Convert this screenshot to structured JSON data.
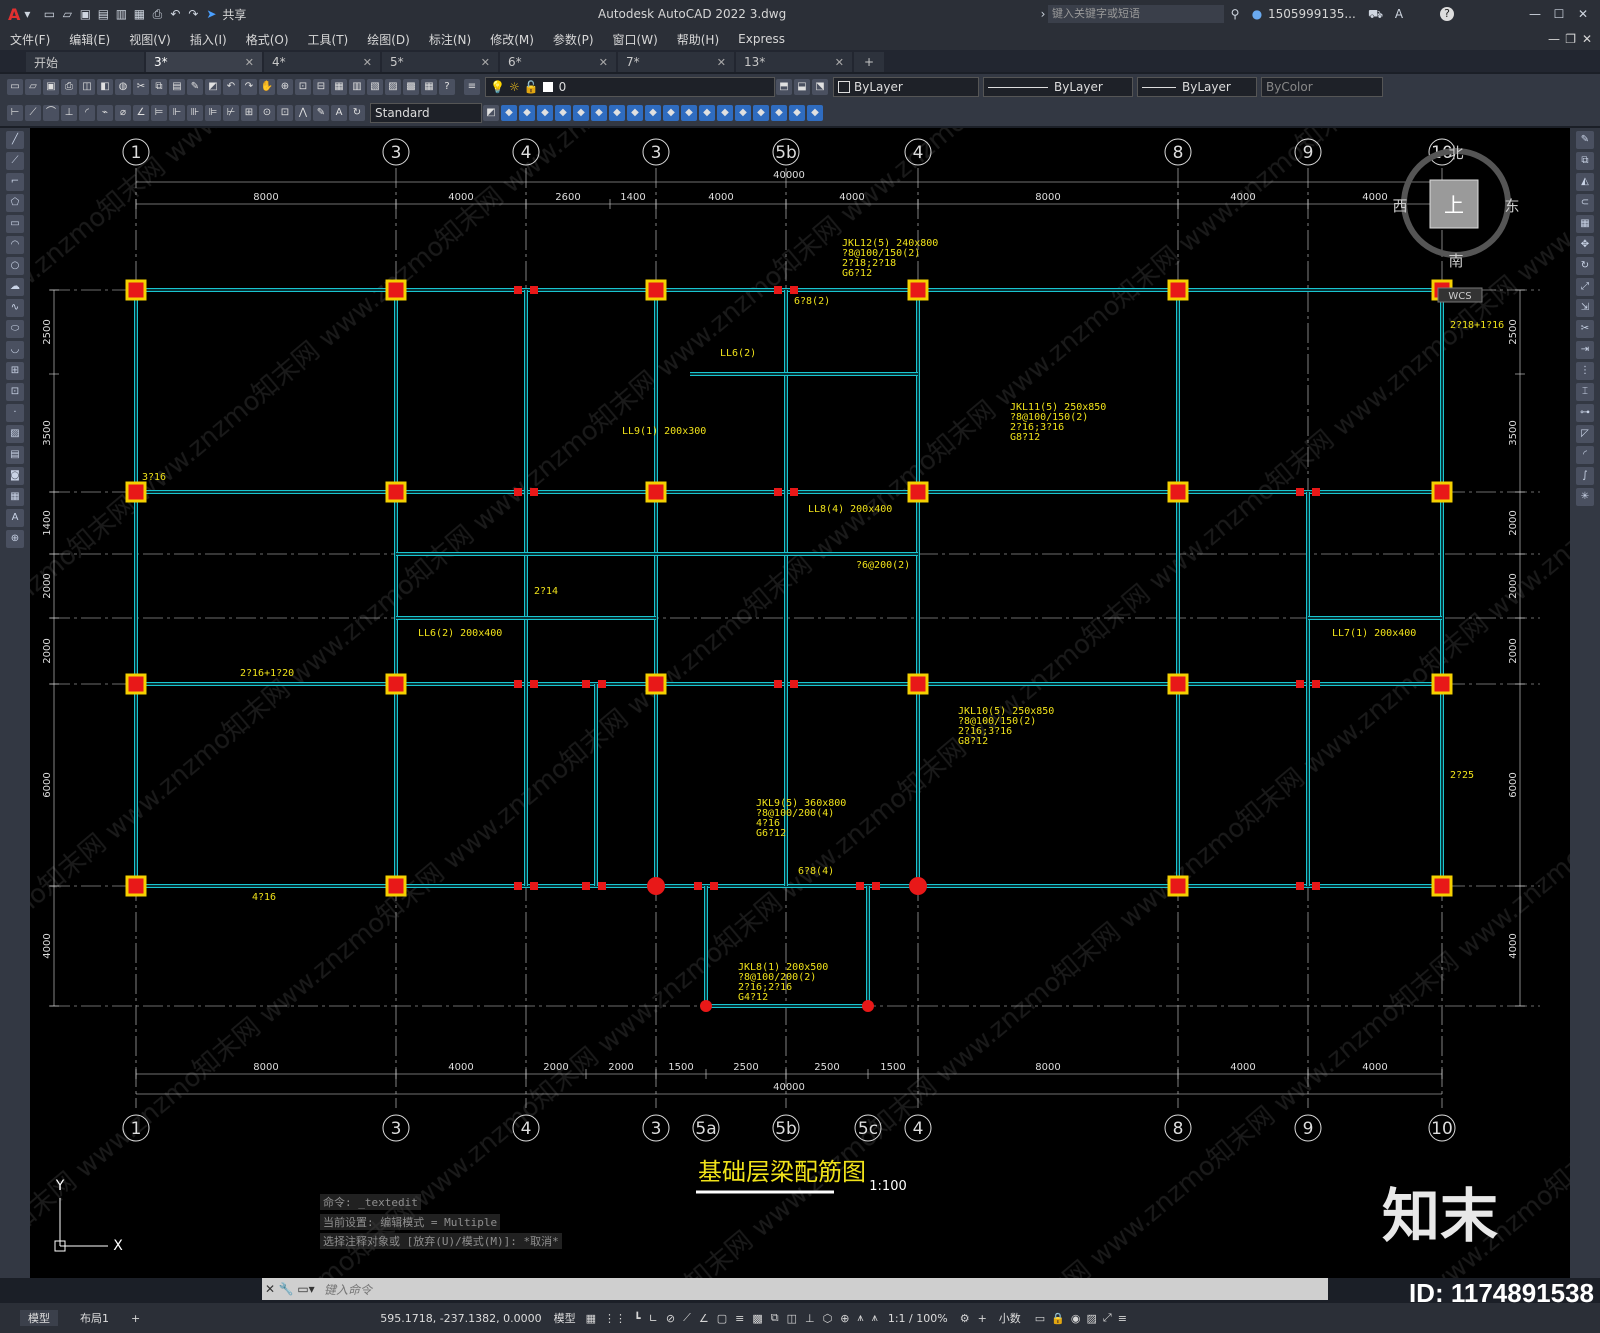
{
  "window": {
    "title": "Autodesk AutoCAD 2022    3.dwg",
    "share": "共享",
    "search_placeholder": "键入关键字或短语",
    "user": "1505999135...",
    "help": "?"
  },
  "menu": [
    "文件(F)",
    "编辑(E)",
    "视图(V)",
    "插入(I)",
    "格式(O)",
    "工具(T)",
    "绘图(D)",
    "标注(N)",
    "修改(M)",
    "参数(P)",
    "窗口(W)",
    "帮助(H)",
    "Express"
  ],
  "tabs": [
    {
      "label": "开始"
    },
    {
      "label": "3*"
    },
    {
      "label": "4*"
    },
    {
      "label": "5*"
    },
    {
      "label": "6*"
    },
    {
      "label": "7*"
    },
    {
      "label": "13*"
    }
  ],
  "toolbar": {
    "layer_value": "0",
    "color": "ByLayer",
    "linetype": "ByLayer",
    "lineweight": "ByLayer",
    "plotstyle": "ByColor",
    "text_style": "Standard"
  },
  "viewcube": {
    "north": "北",
    "south": "南",
    "west": "西",
    "east": "东",
    "top": "上",
    "wcs": "WCS"
  },
  "drawing": {
    "title": "基础层梁配筋图",
    "scale": "1:100",
    "top_axes": [
      "1",
      "3",
      "4",
      "3",
      "5b",
      "4",
      "8",
      "9",
      "10"
    ],
    "bottom_axes": [
      "1",
      "3",
      "4",
      "3",
      "5a",
      "5b",
      "5c",
      "4",
      "8",
      "9",
      "10"
    ],
    "top_total": "40000",
    "bottom_total": "40000",
    "top_dims": [
      "8000",
      "4000",
      "2600",
      "1400",
      "4000",
      "4000",
      "8000",
      "4000",
      "4000"
    ],
    "bottom_dims": [
      "8000",
      "4000",
      "2000",
      "2000",
      "1500",
      "2500",
      "2500",
      "1500",
      "8000",
      "4000",
      "4000"
    ],
    "left_dims": [
      "2500",
      "3500",
      "1400",
      "2000",
      "2000",
      "6000",
      "4000"
    ],
    "right_dims": [
      "2500",
      "3500",
      "2000",
      "2000",
      "2000",
      "6000",
      "4000"
    ],
    "annotations": [
      "JKL12(5) 240x800",
      "?8@100/150(2)",
      "2?18;2?18",
      "G6?12",
      "JKL11(5) 250x850",
      "?8@100/150(2)",
      "2?16;3?16",
      "G8?12",
      "JKL10(5) 250x850",
      "?8@100/150(2)",
      "2?16;3?16",
      "G8?12",
      "JKL9(5) 360x800",
      "?8@100/200(4)",
      "4?16",
      "G6?12",
      "JKL8(1) 200x500",
      "?8@100/200(2)",
      "2?16;2?16",
      "G4?12",
      "LL6(2)",
      "LL6(2) 200x400",
      "LL8(4) 200x400",
      "LL9(1) 200x300",
      "LL7(1) 200x400",
      "3?16",
      "2?16+1?20",
      "4?16",
      "6?8(2)",
      "6?8(4)",
      "?6@200(2)",
      "2?18+1?16",
      "2?25",
      "2?14"
    ]
  },
  "command": {
    "history": [
      "命令: _textedit",
      "当前设置: 编辑模式 = Multiple",
      "选择注释对象或 [放弃(U)/模式(M)]: *取消*"
    ],
    "placeholder": "键入命令"
  },
  "status": {
    "tabs": [
      "模型",
      "布局1"
    ],
    "coords": "595.1718, -237.1382, 0.0000",
    "mode": "模型",
    "scale": "1:1 / 100%",
    "units": "小数"
  },
  "watermark": {
    "brand": "知末",
    "id": "ID: 1174891538"
  }
}
